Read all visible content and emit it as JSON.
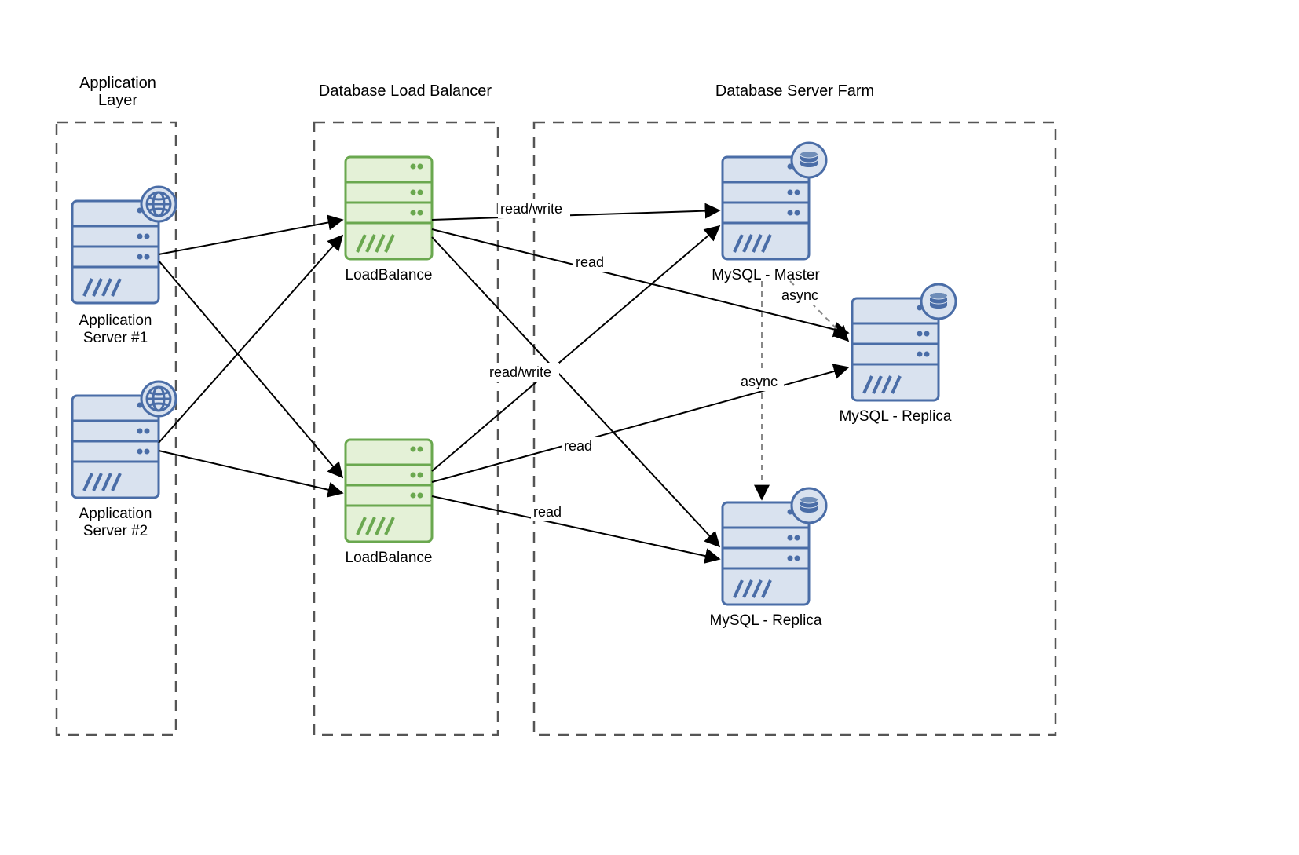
{
  "groups": {
    "app": {
      "title": "Application\nLayer"
    },
    "lb": {
      "title": "Database Load Balancer"
    },
    "db": {
      "title": "Database Server Farm"
    }
  },
  "nodes": {
    "app1": {
      "label": "Application\nServer #1"
    },
    "app2": {
      "label": "Application\nServer #2"
    },
    "lb1": {
      "label": "LoadBalance"
    },
    "lb2": {
      "label": "LoadBalance"
    },
    "dbm": {
      "label": "MySQL - Master"
    },
    "dbr1": {
      "label": "MySQL - Replica"
    },
    "dbr2": {
      "label": "MySQL - Replica"
    }
  },
  "edges": {
    "rw1": {
      "label": "read/write"
    },
    "rw2": {
      "label": "read/write"
    },
    "rd1": {
      "label": "read"
    },
    "rd2": {
      "label": "read"
    },
    "rd3": {
      "label": "read"
    },
    "as1": {
      "label": "async"
    },
    "as2": {
      "label": "async"
    }
  }
}
